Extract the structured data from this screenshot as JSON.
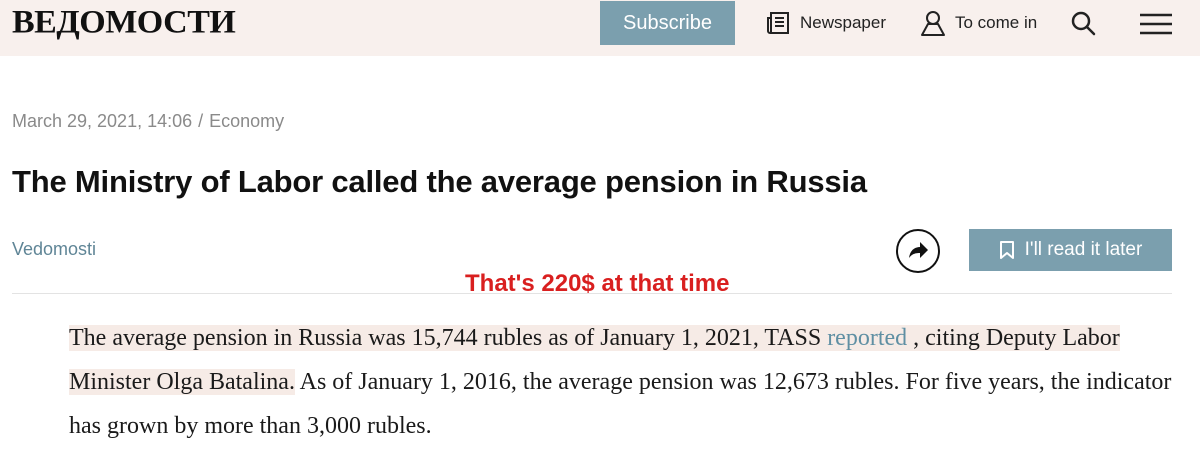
{
  "header": {
    "logo": "ВЕДОМОСТИ",
    "subscribe_label": "Subscribe",
    "newspaper_label": "Newspaper",
    "login_label": "To come in",
    "icons": [
      "newspaper-icon",
      "user-icon",
      "search-icon",
      "menu-icon"
    ]
  },
  "article": {
    "date": "March 29, 2021, 14:06",
    "separator": "/",
    "category": "Economy",
    "title": "The Ministry of Labor called the average pension in Russia",
    "source": "Vedomosti",
    "read_later_label": "I'll read it later",
    "annotation": "That's 220$ at that time",
    "body": {
      "part1": "The average pension in Russia was 15,744 rubles as of January 1, 2021, TASS ",
      "link": "reported",
      "part2": " , citing Deputy Labor Minister Olga Batalina.",
      "part3": " As of January 1, 2016, the average pension was 12,673 rubles. For five years, the indicator has grown by more than 3,000 rubles."
    }
  },
  "colors": {
    "header_bg": "#f8f0ed",
    "accent_button": "#7b9fae",
    "link": "#5f8fa3",
    "annotation": "#d91f1f",
    "highlight": "#f6ebe6"
  }
}
